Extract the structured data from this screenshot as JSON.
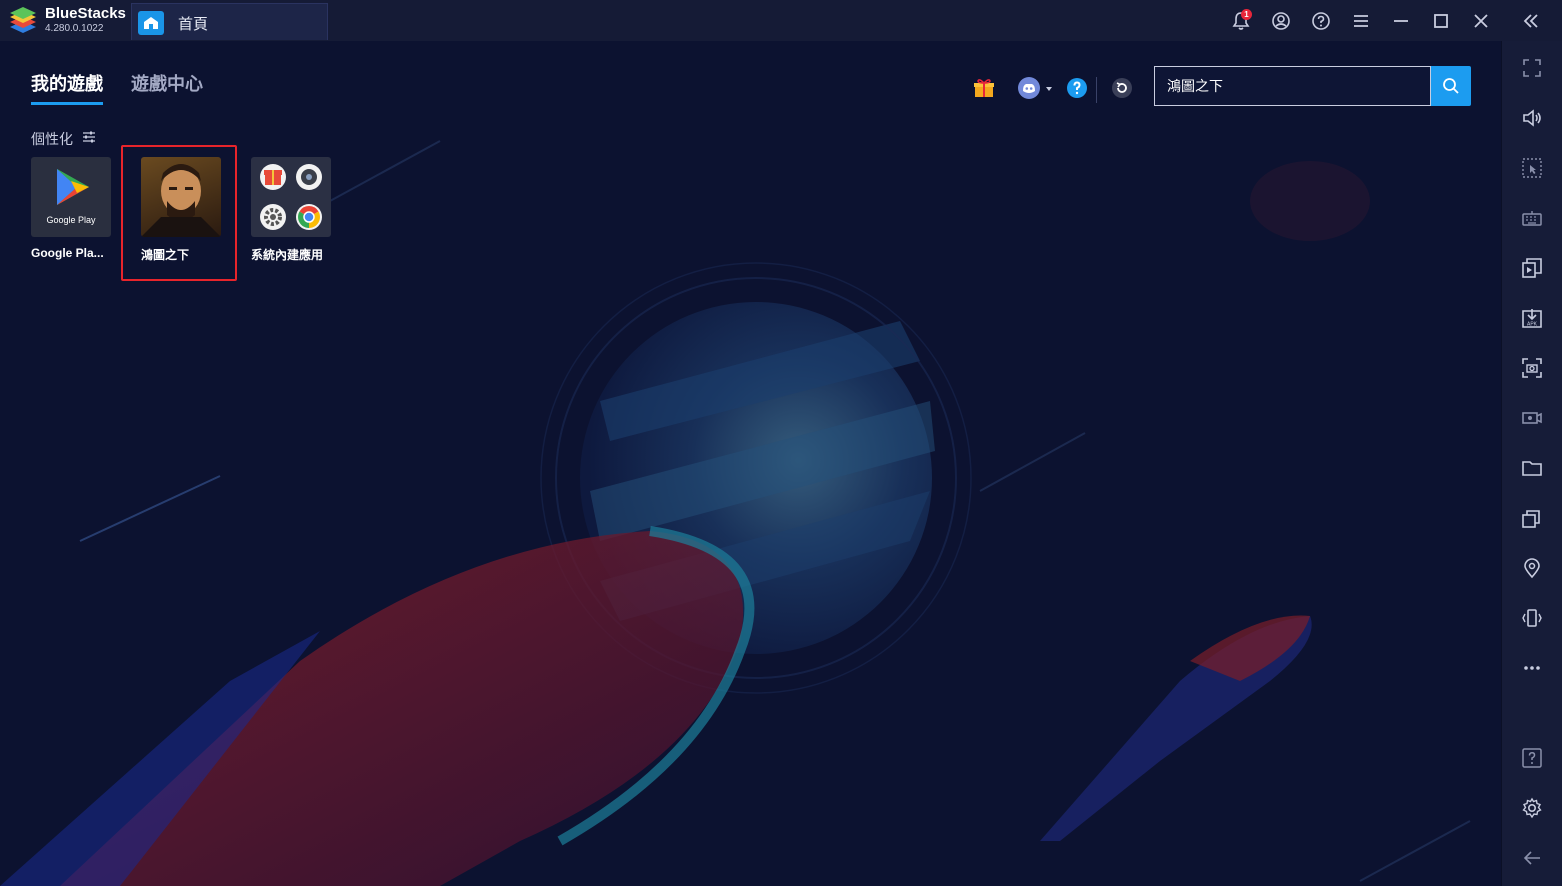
{
  "app": {
    "name": "BlueStacks",
    "version": "4.280.0.1022"
  },
  "tabs": {
    "home_label": "首頁"
  },
  "titlebar": {
    "notification_count": "1",
    "icons": [
      "bell-icon",
      "account-icon",
      "help-icon",
      "menu-icon",
      "minimize-icon",
      "maximize-icon",
      "close-icon",
      "collapse-sidebar-icon"
    ]
  },
  "main": {
    "tabs": [
      {
        "label": "我的遊戲",
        "active": true
      },
      {
        "label": "遊戲中心",
        "active": false
      }
    ],
    "personalize_label": "個性化",
    "apps": [
      {
        "label": "Google Pla...",
        "icon": "google-play-icon",
        "thumb_text": "Google Play"
      },
      {
        "label": "鴻圖之下",
        "icon": "game-portrait-icon"
      },
      {
        "label": "系統內建應用",
        "icon": "system-apps-folder-icon"
      }
    ],
    "search": {
      "value": "鴻圖之下"
    },
    "toolbar_icons": [
      "gift-icon",
      "discord-icon",
      "help-circle-icon",
      "refresh-icon"
    ]
  },
  "sidebar": {
    "icons": [
      "fullscreen-icon",
      "volume-icon",
      "pointer-select-icon",
      "keyboard-icon",
      "multi-instance-icon",
      "apk-install-icon",
      "screenshot-icon",
      "record-icon",
      "folder-icon",
      "multi-window-icon",
      "location-icon",
      "shake-icon",
      "more-icon",
      "help-square-icon",
      "settings-icon",
      "back-arrow-icon"
    ]
  },
  "colors": {
    "accent": "#1c9cf0",
    "highlight": "#e8242b",
    "background": "#0c1230"
  }
}
